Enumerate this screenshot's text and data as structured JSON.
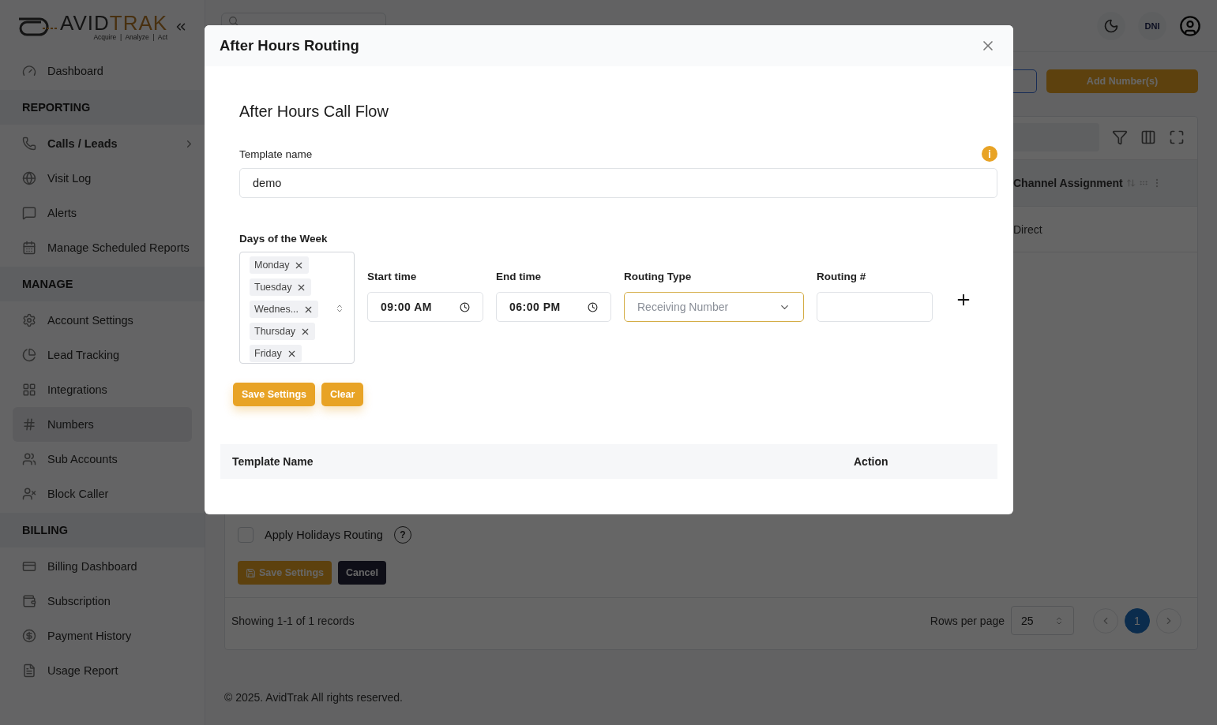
{
  "sidebar": {
    "logo": {
      "word_1": "AVID",
      "word_2": "TRAK",
      "tagline": "Acquire  |  Analyze  |  Act"
    },
    "items": [
      {
        "kind": "link",
        "label": "Dashboard",
        "selected": false
      },
      {
        "kind": "section",
        "label": "REPORTING"
      },
      {
        "kind": "group",
        "label": "Calls / Leads",
        "selected": false
      },
      {
        "kind": "link",
        "label": "Visit Log",
        "selected": false
      },
      {
        "kind": "link",
        "label": "Alerts",
        "selected": false
      },
      {
        "kind": "link",
        "label": "Manage Scheduled Reports",
        "selected": false
      },
      {
        "kind": "section",
        "label": "MANAGE"
      },
      {
        "kind": "link",
        "label": "Account Settings",
        "selected": false
      },
      {
        "kind": "link",
        "label": "Lead Tracking",
        "selected": false
      },
      {
        "kind": "link",
        "label": "Integrations",
        "selected": false
      },
      {
        "kind": "link",
        "label": "Numbers",
        "selected": true
      },
      {
        "kind": "link",
        "label": "Sub Accounts",
        "selected": false
      },
      {
        "kind": "link",
        "label": "Block Caller",
        "selected": false
      },
      {
        "kind": "section",
        "label": "BILLING"
      },
      {
        "kind": "link",
        "label": "Billing Dashboard",
        "selected": false
      },
      {
        "kind": "link",
        "label": "Subscription",
        "selected": false
      },
      {
        "kind": "link",
        "label": "Payment History",
        "selected": false
      },
      {
        "kind": "link",
        "label": "Usage Report",
        "selected": false
      }
    ]
  },
  "header": {
    "badge": "DNI"
  },
  "page": {
    "add_button": "Add Number(s)",
    "table": {
      "columns": [
        "Channel Assignment"
      ],
      "rows": [
        [
          "Direct"
        ]
      ]
    },
    "holidays": {
      "label": "Apply Holidays Routing",
      "checked": false,
      "help": "?"
    },
    "buttons": [
      {
        "kind": "save",
        "label": "Save Settings"
      },
      {
        "kind": "cancel",
        "label": "Cancel"
      }
    ],
    "pagination": {
      "summary": "Showing 1-1 of 1 records",
      "rows_label": "Rows per page",
      "rows_value": "25",
      "pages": [
        {
          "label": "1",
          "selected": true
        }
      ]
    },
    "footer": "© 2025. AvidTrak All rights reserved."
  },
  "modal": {
    "title": "After Hours Routing",
    "heading": "After Hours Call Flow",
    "template_name": {
      "label": "Template name",
      "value": "demo"
    },
    "days": {
      "label": "Days of the Week",
      "chips": [
        "Monday",
        "Tuesday",
        "Wednes...",
        "Thursday",
        "Friday"
      ]
    },
    "start_time": {
      "label": "Start time",
      "value": "09:00 AM"
    },
    "end_time": {
      "label": "End time",
      "value": "06:00 PM"
    },
    "routing_type": {
      "label": "Routing Type",
      "placeholder": "Receiving Number"
    },
    "routing_number": {
      "label": "Routing #"
    },
    "buttons": [
      {
        "kind": "primary",
        "label": "Save Settings"
      },
      {
        "kind": "primary",
        "label": "Clear"
      }
    ],
    "table": {
      "columns": [
        "Template Name",
        "Action"
      ]
    }
  }
}
